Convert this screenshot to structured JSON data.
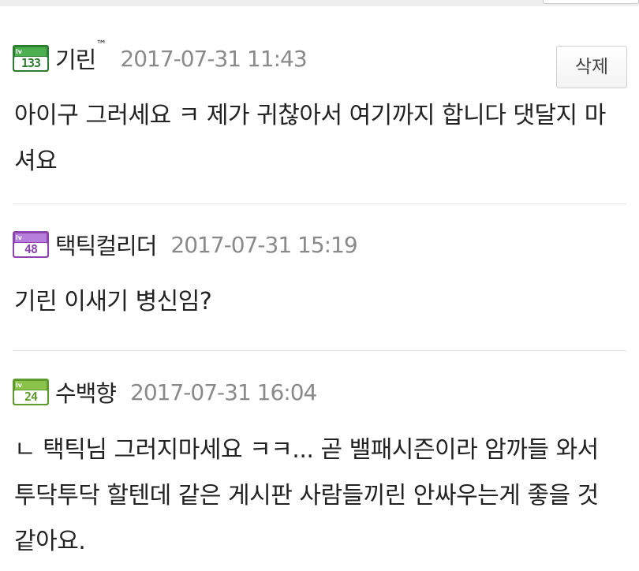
{
  "comments": [
    {
      "level": "133",
      "level_prefix": "lv",
      "level_color": "#3c8a3c",
      "nickname": "기린",
      "nickname_suffix": "™",
      "datetime": "2017-07-31 11:43",
      "delete_label": "삭제",
      "body": "아이구 그러세요 ㅋ 제가 귀찮아서 여기까지 합니다 댓달지 마셔요"
    },
    {
      "level": "48",
      "level_prefix": "lv",
      "level_color": "#9b59d0",
      "nickname": "택틱컬리더",
      "datetime": "2017-07-31 15:19",
      "body": "기린 이새기 병신임?"
    },
    {
      "level": "24",
      "level_prefix": "lv",
      "level_color": "#6fae3a",
      "nickname": "수백향",
      "datetime": "2017-07-31 16:04",
      "body": "ㄴ 택틱님 그러지마세요 ㅋㅋ... 곧 밸패시즌이라 암까들 와서 투닥투닥 할텐데 같은 게시판 사람들끼린 안싸우는게 좋을 것 같아요."
    }
  ]
}
